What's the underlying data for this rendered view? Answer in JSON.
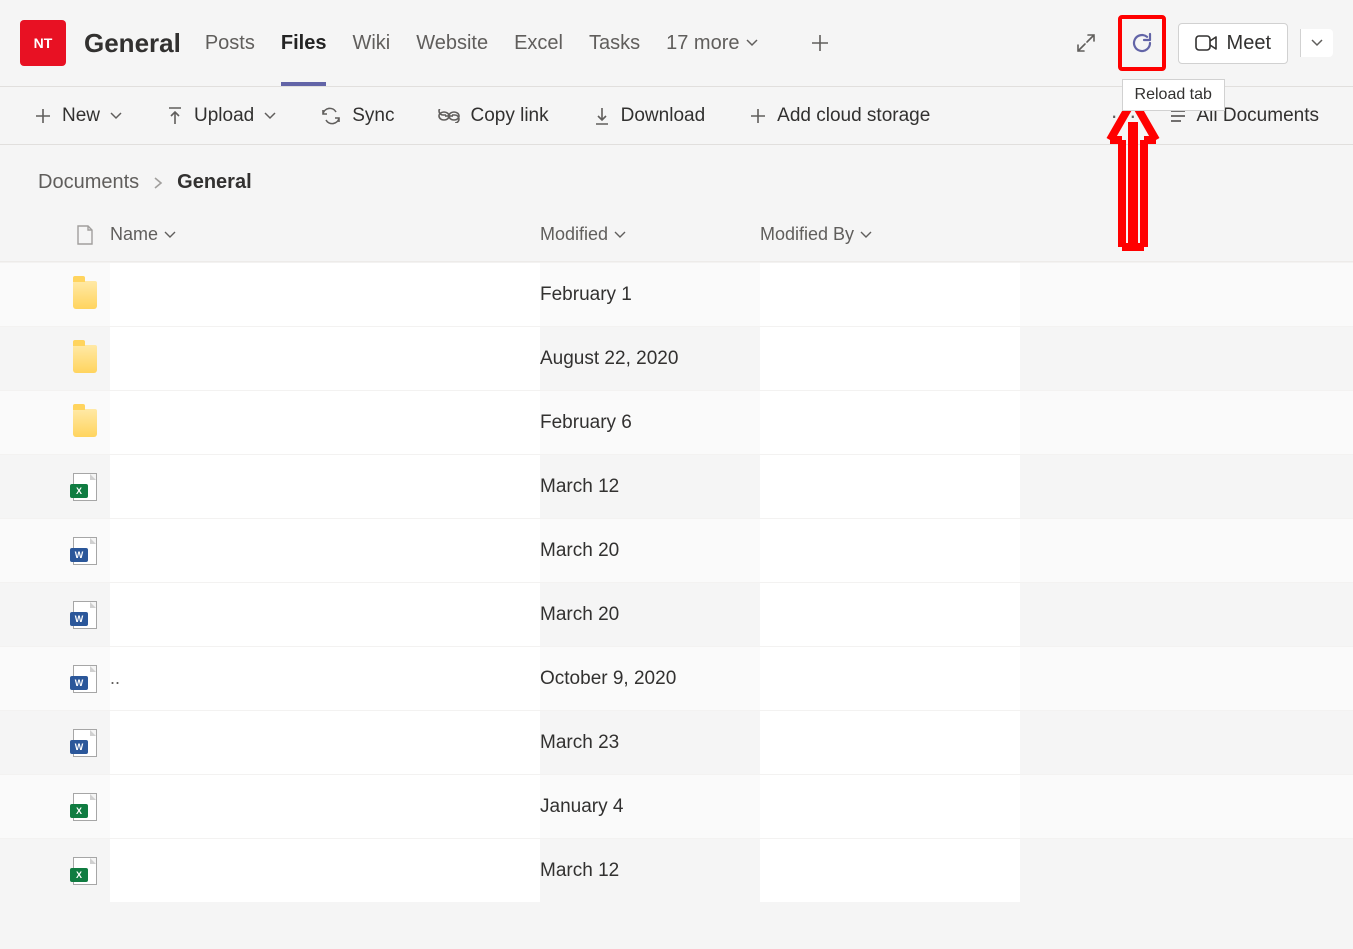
{
  "header": {
    "team_initials": "NT",
    "channel": "General",
    "tabs": [
      "Posts",
      "Files",
      "Wiki",
      "Website",
      "Excel",
      "Tasks"
    ],
    "active_tab": "Files",
    "more_label": "17 more",
    "meet_label": "Meet",
    "reload_tooltip": "Reload tab"
  },
  "commands": {
    "new": "New",
    "upload": "Upload",
    "sync": "Sync",
    "copylink": "Copy link",
    "download": "Download",
    "addcloud": "Add cloud storage",
    "view": "All Documents"
  },
  "breadcrumb": {
    "root": "Documents",
    "current": "General"
  },
  "columns": {
    "name": "Name",
    "modified": "Modified",
    "modifiedby": "Modified By"
  },
  "rows": [
    {
      "icon": "folder",
      "name": "",
      "modified": "February 1",
      "modifiedby": ""
    },
    {
      "icon": "folder",
      "name": "",
      "modified": "August 22, 2020",
      "modifiedby": ""
    },
    {
      "icon": "folder",
      "name": "",
      "modified": "February 6",
      "modifiedby": ""
    },
    {
      "icon": "excel",
      "name": "",
      "modified": "March 12",
      "modifiedby": ""
    },
    {
      "icon": "word",
      "name": "",
      "modified": "March 20",
      "modifiedby": ""
    },
    {
      "icon": "word",
      "name": "",
      "modified": "March 20",
      "modifiedby": ""
    },
    {
      "icon": "word",
      "name": "",
      "modified": "October 9, 2020",
      "modifiedby": "",
      "truncated": true
    },
    {
      "icon": "word",
      "name": "",
      "modified": "March 23",
      "modifiedby": ""
    },
    {
      "icon": "excel",
      "name": "",
      "modified": "January 4",
      "modifiedby": ""
    },
    {
      "icon": "excel",
      "name": "",
      "modified": "March 12",
      "modifiedby": ""
    }
  ]
}
